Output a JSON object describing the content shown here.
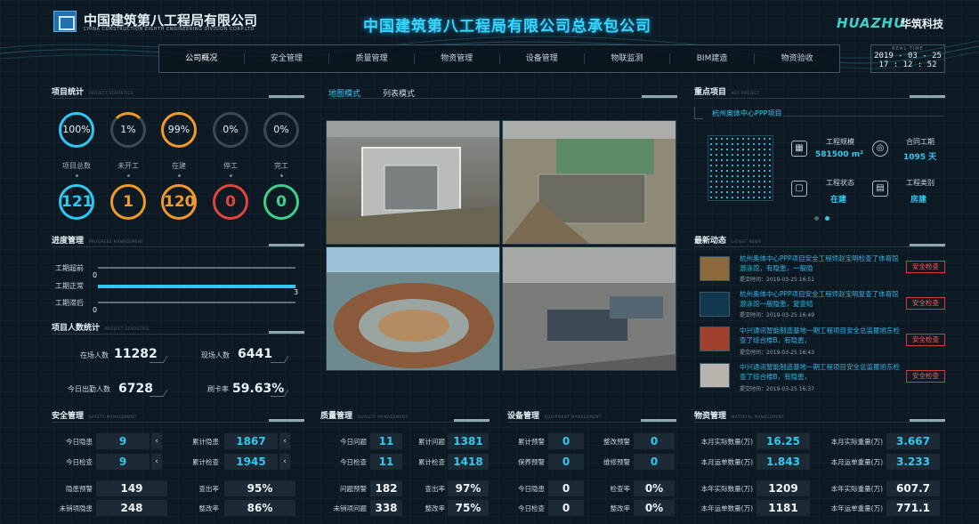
{
  "header": {
    "company_name": "中国建筑第八工程局有限公司",
    "company_en": "CHINA CONSTRUCTION EIGHTH ENGINEERING DIVISION CORP.LTD",
    "main_title": "中国建筑第八工程局有限公司总承包公司",
    "brand_en": "HUAZHU",
    "brand_cn": "华筑科技",
    "clock_label": "REAL TIME",
    "date": "2019 - 03 - 25",
    "time": "17 : 12 : 52"
  },
  "nav": [
    "公司概况",
    "安全管理",
    "质量管理",
    "物资管理",
    "设备管理",
    "物联监测",
    "BIM建造",
    "物资验收"
  ],
  "project_stats": {
    "title": "项目统计",
    "title_en": "PROJECT STATISTICS",
    "gauges": [
      {
        "pct": "100%",
        "label": "项目总数",
        "count": "121",
        "color": "#2fc8f0",
        "fill": 1.0
      },
      {
        "pct": "1%",
        "label": "未开工",
        "count": "1",
        "color": "#f09a2a",
        "fill": 0.01
      },
      {
        "pct": "99%",
        "label": "在建",
        "count": "120",
        "color": "#f09a2a",
        "fill": 0.99
      },
      {
        "pct": "0%",
        "label": "停工",
        "count": "0",
        "color": "#e0443a",
        "fill": 0
      },
      {
        "pct": "0%",
        "label": "完工",
        "count": "0",
        "color": "#3ed08a",
        "fill": 0
      }
    ]
  },
  "progress": {
    "title": "进度管理",
    "title_en": "PROGRESS MANAGEMENT",
    "rows": [
      {
        "label": "工期超前",
        "value": "0",
        "fill": 0
      },
      {
        "label": "工期正常",
        "value": "3",
        "fill": 1.0
      },
      {
        "label": "工期滞后",
        "value": "0",
        "fill": 0
      }
    ]
  },
  "people": {
    "title": "项目人数统计",
    "title_en": "PROJECT STATISTICS",
    "onsite_label": "在场人数",
    "onsite": "11282",
    "present_label": "现场人数",
    "present": "6441",
    "today_label": "今日出勤人数",
    "today": "6728",
    "rate_label": "刷卡率",
    "rate": "59.63%"
  },
  "map": {
    "tab_map": "地图模式",
    "tab_list": "列表模式"
  },
  "key_project": {
    "title": "重点项目",
    "title_en": "KEY PROJECT",
    "name": "杭州奥体中心PPP项目",
    "scale_label": "工程规模",
    "scale": "581500 m²",
    "period_label": "合同工期",
    "period": "1095 天",
    "status_label": "工程状态",
    "status": "在建",
    "type_label": "工程类别",
    "type": "房建"
  },
  "news": {
    "title": "最新动态",
    "title_en": "LATEST NEWS",
    "items": [
      {
        "text": "杭州奥体中心PPP项目安全工程师赵宝明检查了体育馆 游泳馆，有隐患，一般隐",
        "time": "提交时间：2019-03-25 16:51",
        "badge": "安全检查"
      },
      {
        "text": "杭州奥体中心PPP项目安全工程师赵宝明复查了体育馆 游泳馆一般隐患，复查结",
        "time": "提交时间：2019-03-25 16:49",
        "badge": "安全检查"
      },
      {
        "text": "中兴通讯智能制造基地一期工程项目安全总监瞿旭东检查了综合楼B，有隐患，",
        "time": "提交时间：2019-03-25 16:43",
        "badge": "安全检查"
      },
      {
        "text": "中兴通讯智能制造基地一期工程项目安全总监瞿旭东检查了综合楼B，有隐患，",
        "time": "提交时间：2019-03-25 16:37",
        "badge": "安全检查"
      }
    ]
  },
  "safety": {
    "title": "安全管理",
    "title_en": "SAFETY MANAGEMENT",
    "today_hazard_label": "今日隐患",
    "today_hazard": "9",
    "total_hazard_label": "累计隐患",
    "total_hazard": "1867",
    "today_check_label": "今日检查",
    "today_check": "9",
    "total_check_label": "累计检查",
    "total_check": "1945",
    "warn_label": "隐患预警",
    "warn": "149",
    "found_label": "查出率",
    "found": "95%",
    "open_label": "未销项隐患",
    "open": "248",
    "fix_label": "整改率",
    "fix": "86%"
  },
  "quality": {
    "title": "质量管理",
    "title_en": "QUALITY MANAGEMENT",
    "today_issue_label": "今日问题",
    "today_issue": "11",
    "total_issue_label": "累计问题",
    "total_issue": "1381",
    "today_check_label": "今日检查",
    "today_check": "11",
    "total_check_label": "累计检查",
    "total_check": "1418",
    "warn_label": "问题预警",
    "warn": "182",
    "found_label": "查出率",
    "found": "97%",
    "open_label": "未销项问题",
    "open": "338",
    "fix_label": "整改率",
    "fix": "75%"
  },
  "equipment": {
    "title": "设备管理",
    "title_en": "EQUIPMENT MANAGEMENT",
    "acc_warn_label": "累计预警",
    "acc_warn": "0",
    "fix_warn_label": "整改预警",
    "fix_warn": "0",
    "maint_warn_label": "保养预警",
    "maint_warn": "0",
    "repair_warn_label": "维修预警",
    "repair_warn": "0",
    "today_hazard_label": "今日隐患",
    "today_hazard": "0",
    "check_rate_label": "检查率",
    "check_rate": "0%",
    "today_check_label": "今日检查",
    "today_check": "0",
    "fix_rate_label": "整改率",
    "fix_rate": "0%"
  },
  "material": {
    "title": "物资管理",
    "title_en": "MATERIAL MANAGEMENT",
    "m_actual_qty_label": "本月实际数量(万)",
    "m_actual_qty": "16.25",
    "m_actual_wt_label": "本月实际重量(万)",
    "m_actual_wt": "3.667",
    "m_bill_qty_label": "本月运单数量(万)",
    "m_bill_qty": "1.843",
    "m_bill_wt_label": "本月运单重量(万)",
    "m_bill_wt": "3.233",
    "y_actual_qty_label": "本年实际数量(万)",
    "y_actual_qty": "1209",
    "y_actual_wt_label": "本年实际重量(万)",
    "y_actual_wt": "607.7",
    "y_bill_qty_label": "本年运单数量(万)",
    "y_bill_qty": "1181",
    "y_bill_wt_label": "本年运单重量(万)",
    "y_bill_wt": "771.1"
  }
}
